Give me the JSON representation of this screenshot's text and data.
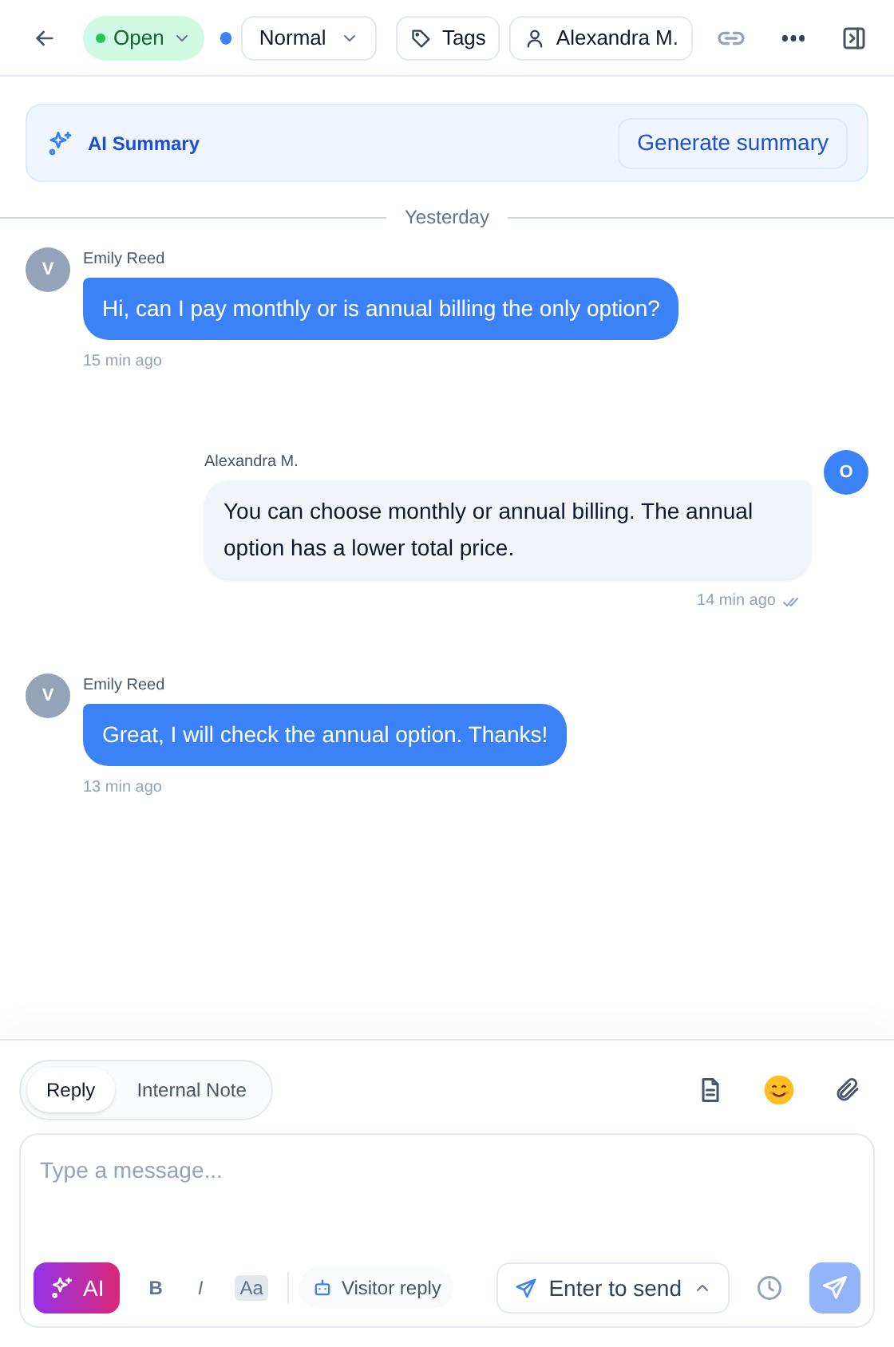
{
  "header": {
    "status": {
      "label": "Open",
      "color": "#22c55e"
    },
    "priority": {
      "label": "Normal",
      "color": "#3b82f6"
    },
    "tags_button": "Tags",
    "assignee": "Alexandra M."
  },
  "ai_summary": {
    "title": "AI Summary",
    "button": "Generate summary"
  },
  "date_divider": "Yesterday",
  "messages": [
    {
      "kind": "visitor",
      "avatar": "V",
      "author": "Emily Reed",
      "text": "Hi, can I pay monthly or is annual billing the only option?",
      "time": "15 min ago",
      "read": false
    },
    {
      "kind": "agent",
      "avatar": "O",
      "author": "Alexandra M.",
      "text": "You can choose monthly or annual billing. The annual option has a lower total price.",
      "time": "14 min ago",
      "read": true
    },
    {
      "kind": "visitor",
      "avatar": "V",
      "author": "Emily Reed",
      "text": "Great, I will check the annual option. Thanks!",
      "time": "13 min ago",
      "read": false
    }
  ],
  "composer": {
    "tabs": [
      {
        "label": "Reply",
        "selected": true
      },
      {
        "label": "Internal Note",
        "selected": false
      }
    ],
    "placeholder": "Type a message...",
    "ai_button": "AI",
    "bold": "B",
    "italic": "I",
    "format": "Aa",
    "visitor_reply": "Visitor reply",
    "send_mode": "Enter to send"
  }
}
